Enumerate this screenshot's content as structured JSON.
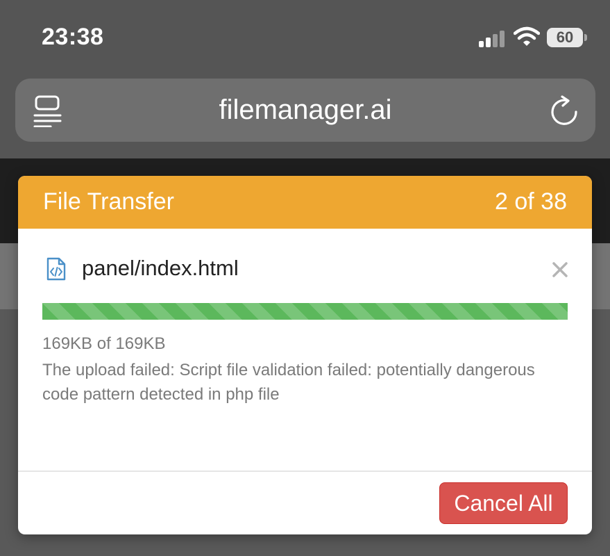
{
  "status_bar": {
    "time": "23:38",
    "battery": "60",
    "icons": [
      "signal-icon",
      "wifi-icon",
      "battery-icon"
    ]
  },
  "browser": {
    "url": "filemanager.ai",
    "icons": [
      "reader-mode-icon",
      "reload-icon"
    ]
  },
  "modal": {
    "title": "File Transfer",
    "count": "2 of 38",
    "file": {
      "name": "panel/index.html",
      "icon": "code-file-icon",
      "progress_percent": 100,
      "size_text": "169KB of 169KB",
      "error": "The upload failed: Script file validation failed: potentially dangerous code pattern detected in php file"
    },
    "cancel_label": "Cancel All"
  },
  "colors": {
    "header": "#eea731",
    "progress": "#5cb85c",
    "cancel": "#d9534f"
  }
}
